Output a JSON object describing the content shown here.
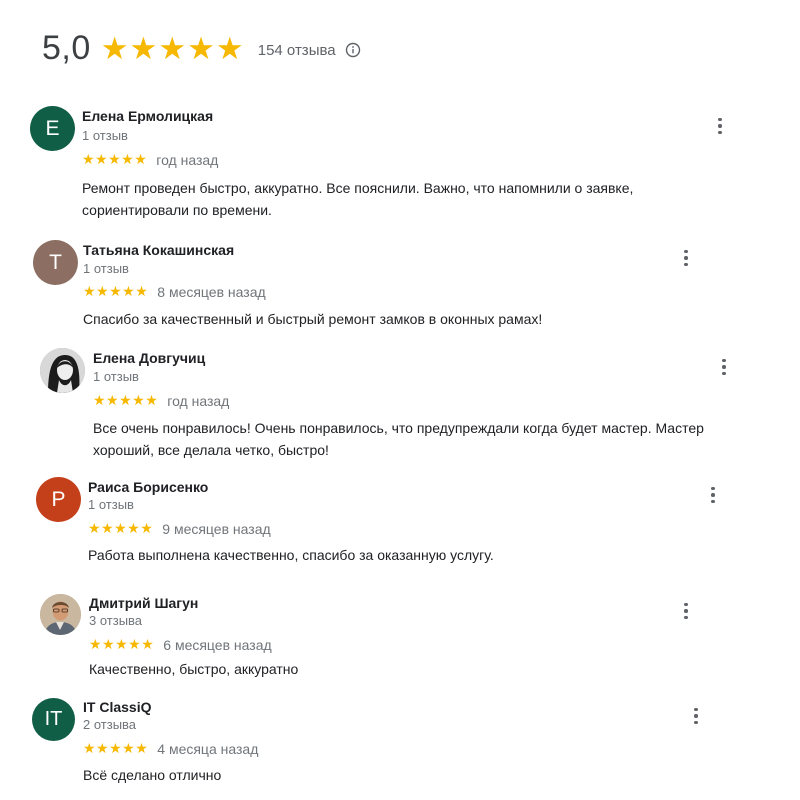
{
  "summary": {
    "rating": "5,0",
    "stars": "★★★★★",
    "count": "154 отзыва"
  },
  "colors": {
    "star": "#f6b800"
  },
  "icons": {
    "info": "info-icon",
    "menu": "more-vert-icon"
  },
  "reviews": [
    {
      "initial": "E",
      "avatar_color": "#115e46",
      "author": "Елена Ермолицкая",
      "meta": "1 отзыв",
      "stars": "★★★★★",
      "date": "год назад",
      "text": "Ремонт  проведен быстро, аккуратно.  Все пояснили. Важно, что напомнили о заявке, сориентировали по времени."
    },
    {
      "initial": "T",
      "avatar_color": "#8c6e62",
      "author": "Татьяна Кокашинская",
      "meta": "1 отзыв",
      "stars": "★★★★★",
      "date": "8 месяцев назад",
      "text": "Спасибо за качественный и быстрый ремонт замков в оконных рамах!"
    },
    {
      "initial": "",
      "avatar_color": "#9a9a9a",
      "author": "Елена Довгучиц",
      "meta": "1 отзыв",
      "stars": "★★★★★",
      "date": "год назад",
      "text": "Все очень понравилось! Очень понравилось, что предупреждали когда будет мастер. Мастер хороший, все делала четко, быстро!"
    },
    {
      "initial": "P",
      "avatar_color": "#c4401a",
      "author": "Раиса Борисенко",
      "meta": "1 отзыв",
      "stars": "★★★★★",
      "date": "9 месяцев назад",
      "text": "Работа выполнена качественно, спасибо за оказанную услугу."
    },
    {
      "initial": "",
      "avatar_color": "#b9a892",
      "author": "Дмитрий Шагун",
      "meta": "3 отзыва",
      "stars": "★★★★★",
      "date": "6 месяцев назад",
      "text": "Качественно, быстро, аккуратно"
    },
    {
      "initial": "IT",
      "avatar_color": "#115e46",
      "author": "IT ClassiQ",
      "meta": "2 отзыва",
      "stars": "★★★★★",
      "date": "4 месяца назад",
      "text": "Всё сделано отлично"
    }
  ]
}
